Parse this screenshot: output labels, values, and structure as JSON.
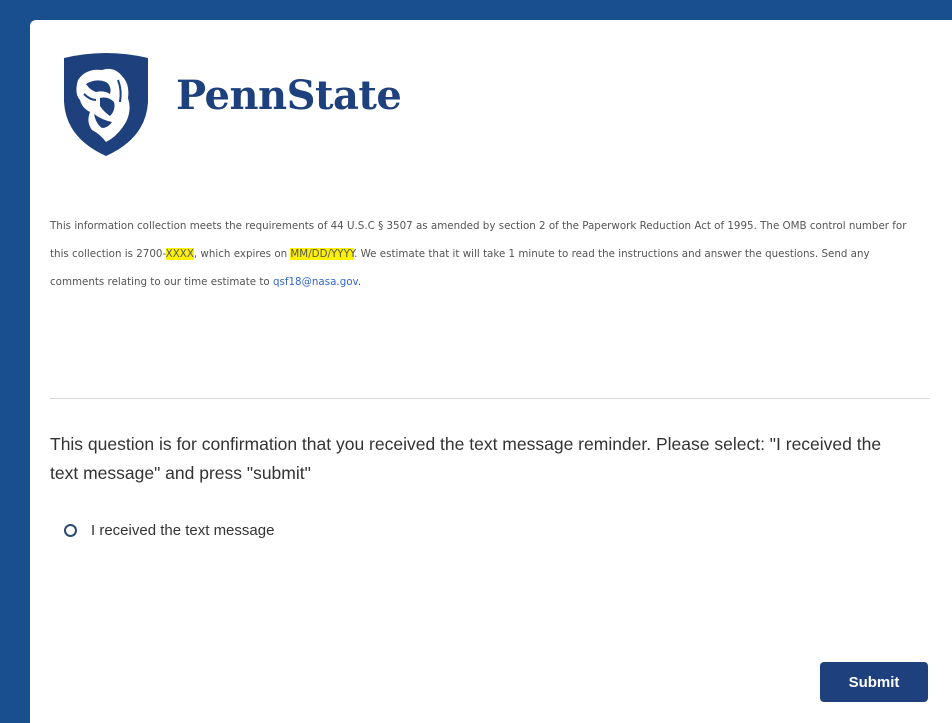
{
  "brand": {
    "name": "PennState",
    "logo_icon": "nittany-lion-shield-icon",
    "primary_color": "#1e407c",
    "frame_color": "#1a4f8f"
  },
  "notice": {
    "part1": "This information collection meets the requirements of 44 U.S.C § 3507 as amended by section 2 of the Paperwork Reduction Act of 1995. The OMB control number for this collection is 2700-",
    "control_placeholder": "XXXX",
    "part2": ", which expires on ",
    "expiry_placeholder": "MM/DD/YYYY",
    "part3": ".   We estimate that it will take 1 minute to read the instructions and answer the questions.  Send any comments relating to our time estimate to ",
    "email": "qsf18@nasa.gov",
    "part4": ".",
    "highlight_color": "#fff200"
  },
  "question": {
    "text": "This question is for confirmation that you received the text message reminder.  Please select: \"I received the text message\" and press \"submit\"",
    "options": [
      {
        "label": "I received the text message",
        "selected": false
      }
    ]
  },
  "actions": {
    "submit_label": "Submit"
  }
}
